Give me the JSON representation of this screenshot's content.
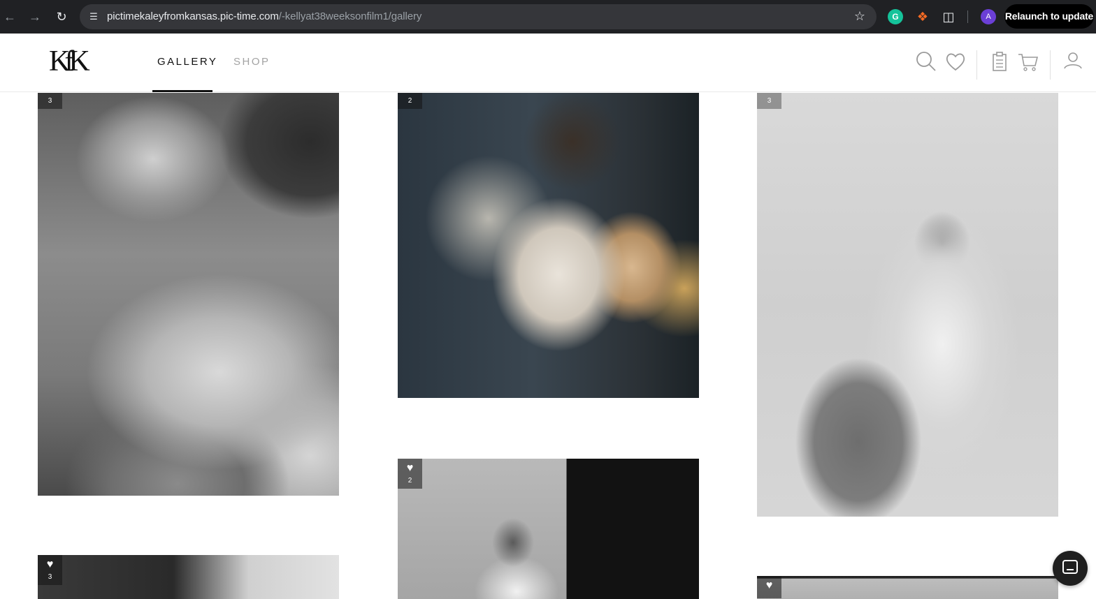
{
  "browser": {
    "url_host": "pictimekaleyfromkansas.pic-time.com",
    "url_path": "/-kellyat38weeksonfilm1/gallery",
    "profile_initial": "A",
    "relaunch_label": "Relaunch to update",
    "icons": [
      "back-icon",
      "forward-icon",
      "reload-icon",
      "site-info-icon",
      "bookmark-star-icon",
      "grammarly-icon",
      "extension-icon",
      "extensions-puzzle-icon"
    ]
  },
  "header": {
    "logo": "KfK",
    "menu": [
      {
        "label": "GALLERY",
        "active": true
      },
      {
        "label": "SHOP",
        "active": false
      }
    ],
    "icons": [
      "search-icon",
      "favorites-heart-icon",
      "orders-clipboard-icon",
      "cart-icon",
      "account-icon"
    ]
  },
  "gallery": {
    "tiles": [
      {
        "badge": "3",
        "heart": false,
        "colorway": "black-and-white"
      },
      {
        "badge": "2",
        "heart": false,
        "colorway": "color"
      },
      {
        "badge": "3",
        "heart": false,
        "colorway": "black-and-white"
      },
      {
        "badge": "2",
        "heart": true,
        "colorway": "black-and-white"
      },
      {
        "badge": "3",
        "heart": true,
        "colorway": "black-and-white"
      },
      {
        "badge": "",
        "heart": true,
        "colorway": "black-and-white"
      }
    ]
  },
  "colors": {
    "chrome_bg": "#202124",
    "omnibox_bg": "#35363a",
    "accent_underline": "#111111",
    "menu_inactive": "#a3a3a3"
  }
}
